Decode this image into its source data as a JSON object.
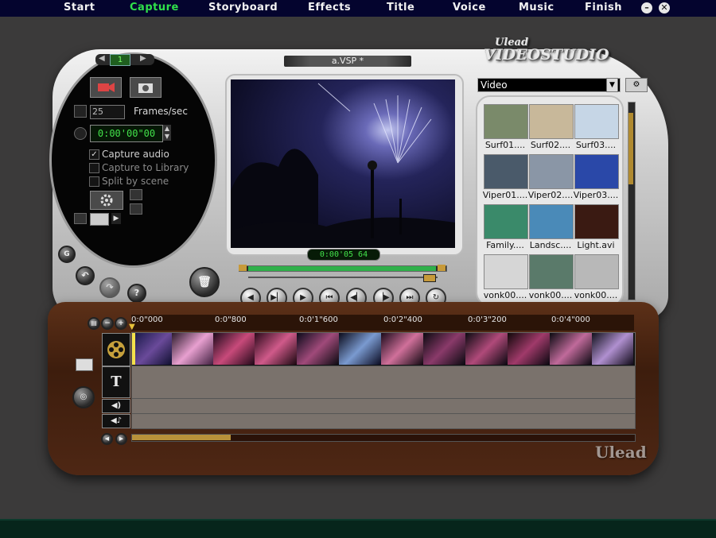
{
  "menu": {
    "items": [
      {
        "label": "Start",
        "active": false
      },
      {
        "label": "Capture",
        "active": true
      },
      {
        "label": "Storyboard",
        "active": false
      },
      {
        "label": "Effects",
        "active": false
      },
      {
        "label": "Title",
        "active": false
      },
      {
        "label": "Voice",
        "active": false
      },
      {
        "label": "Music",
        "active": false
      },
      {
        "label": "Finish",
        "active": false
      }
    ],
    "minimize_icon": "minus-icon",
    "close_icon": "close-icon"
  },
  "colors": {
    "active_menu": "#2fe04a",
    "timecode": "#42e24a",
    "wood": "#4e2714"
  },
  "capture_panel": {
    "page_number": "1",
    "frame_rate_value": "25",
    "frame_rate_label": "Frames/sec",
    "timecode": "0:00'00\"00",
    "options": [
      {
        "label": "Capture audio",
        "checked": true
      },
      {
        "label": "Capture to Library",
        "checked": false
      },
      {
        "label": "Split by scene",
        "checked": false
      }
    ]
  },
  "preview": {
    "project_title": "a.VSP *",
    "timecode": "0:00'05 64"
  },
  "library": {
    "logo_top": "Ulead",
    "logo_main": "VIDEOSTUDIO",
    "category": "Video",
    "items": [
      {
        "label": "Surf01....",
        "color": "#7a8a6a"
      },
      {
        "label": "Surf02....",
        "color": "#c8b89a"
      },
      {
        "label": "Surf03....",
        "color": "#c6d6e6"
      },
      {
        "label": "Viper01....",
        "color": "#4a5a6a"
      },
      {
        "label": "Viper02....",
        "color": "#8a96a6"
      },
      {
        "label": "Viper03....",
        "color": "#2a48a8"
      },
      {
        "label": "Family....",
        "color": "#3a8a6a"
      },
      {
        "label": "Landsc....",
        "color": "#4a8ab8"
      },
      {
        "label": "Light.avi",
        "color": "#3a1a12"
      },
      {
        "label": "vonk00....",
        "color": "#d6d6d6"
      },
      {
        "label": "vonk00....",
        "color": "#5a7a6a"
      },
      {
        "label": "vonk00....",
        "color": "#b8b8b8"
      }
    ]
  },
  "timeline": {
    "ticks": [
      "0:0\"000",
      "0:0\"800",
      "0:0'1\"600",
      "0:0'2\"400",
      "0:0'3\"200",
      "0:0'4\"000"
    ],
    "title_track_icon": "T",
    "brand": "Ulead"
  }
}
